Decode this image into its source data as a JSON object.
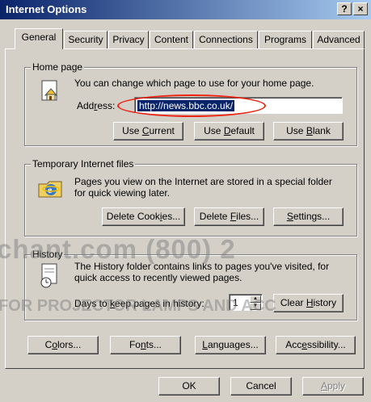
{
  "window": {
    "title": "Internet Options",
    "help_btn": "?",
    "close_btn": "×"
  },
  "tabs": [
    {
      "label": "General"
    },
    {
      "label": "Security"
    },
    {
      "label": "Privacy"
    },
    {
      "label": "Content"
    },
    {
      "label": "Connections"
    },
    {
      "label": "Programs"
    },
    {
      "label": "Advanced"
    }
  ],
  "home_page": {
    "title": "Home page",
    "description": "You can change which page to use for your home page.",
    "address_label_pre": "Add",
    "address_label_u": "r",
    "address_label_post": "ess:",
    "address_value": "http://news.bbc.co.uk/",
    "use_current_pre": "Use ",
    "use_current_u": "C",
    "use_current_post": "urrent",
    "use_default_pre": "Use ",
    "use_default_u": "D",
    "use_default_post": "efault",
    "use_blank_pre": "Use ",
    "use_blank_u": "B",
    "use_blank_post": "lank"
  },
  "temp_files": {
    "title": "Temporary Internet files",
    "description_1": "Pages you view on the Internet are stored in a special folder",
    "description_2": "for quick viewing later.",
    "delete_cookies_pre": "Delete Cook",
    "delete_cookies_u": "i",
    "delete_cookies_post": "es...",
    "delete_files_pre": "Delete ",
    "delete_files_u": "F",
    "delete_files_post": "iles...",
    "settings_u": "S",
    "settings_post": "ettings..."
  },
  "history": {
    "title": "History",
    "description_1": "The History folder contains links to pages you've visited, for",
    "description_2": "quick access to recently viewed pages.",
    "days_pre": "Days to ",
    "days_u": "k",
    "days_post": "eep pages in history:",
    "days_value": "1",
    "clear_pre": "Clear ",
    "clear_u": "H",
    "clear_post": "istory"
  },
  "bottom_buttons": {
    "colors_pre": "C",
    "colors_u": "o",
    "colors_post": "lors...",
    "fonts_pre": "Fo",
    "fonts_u": "n",
    "fonts_post": "ts...",
    "languages_u": "L",
    "languages_post": "anguages...",
    "accessibility_pre": "Acc",
    "accessibility_u": "e",
    "accessibility_post": "ssibility..."
  },
  "dialog_buttons": {
    "ok": "OK",
    "cancel": "Cancel",
    "apply_u": "A",
    "apply_post": "pply"
  },
  "watermark": {
    "line1": "chant.com (800) 2",
    "line2": "FOR PROJECTOR LAMPS AND ACC"
  },
  "icons": {
    "home_page": "home-page-icon",
    "temp_files": "ie-folder-icon",
    "history": "history-clock-icon"
  },
  "colors": {
    "titlebar_start": "#0a246a",
    "titlebar_end": "#a6caf0",
    "face": "#d4d0c8",
    "highlight": "#0a246a",
    "annotation": "#e21"
  }
}
